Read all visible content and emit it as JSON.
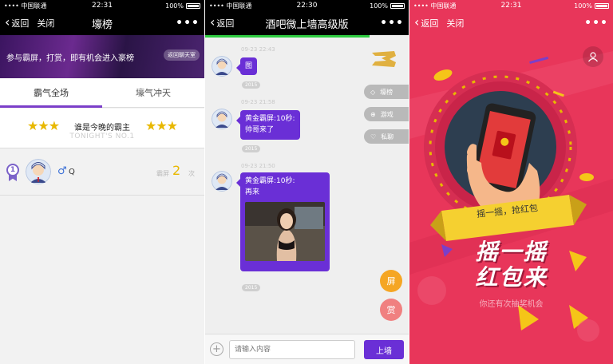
{
  "status": [
    {
      "carrier": "•••• 中国联通",
      "time": "22:31",
      "battery": "100%"
    },
    {
      "carrier": "•••• 中国联通",
      "time": "22:30",
      "battery": "100%"
    },
    {
      "carrier": "•••• 中国联通",
      "time": "22:31",
      "battery": "100%"
    }
  ],
  "panel1": {
    "nav": {
      "back": "返回",
      "close": "关闭",
      "title": "壕榜",
      "more": "•••"
    },
    "banner": {
      "text": "参与霸屏，打赏，即有机会进入豪榜",
      "button": "返回聊天室"
    },
    "tabs": [
      {
        "label": "霸气全场",
        "active": true
      },
      {
        "label": "壕气冲天",
        "active": false
      }
    ],
    "hero": {
      "stars": "★★★",
      "title": "谁是今晚的霸主",
      "subtitle": "TONIGHT'S NO.1"
    },
    "rank": {
      "position": "1",
      "gender_icon": "male-icon",
      "name": "Q",
      "score_label": "霸屏",
      "score": "2",
      "unit": "次"
    }
  },
  "panel2": {
    "nav": {
      "back": "返回",
      "title": "酒吧微上墙高级版",
      "more": "•••"
    },
    "messages": [
      {
        "time": "09-23 22:43",
        "sender": "",
        "text": "图",
        "tag": "2015"
      },
      {
        "time": "09-23 21:58",
        "sender": "黄金霸屏:10秒:",
        "text": "帅哥来了",
        "tag": "2015"
      },
      {
        "time": "09-23 21:50",
        "sender": "黄金霸屏:10秒:",
        "text": "再来",
        "tag": "2015"
      }
    ],
    "side_buttons": [
      {
        "label": "壕榜",
        "icon": "diamond-icon"
      },
      {
        "label": "游戏",
        "icon": "gamepad-icon"
      },
      {
        "label": "私聊",
        "icon": "heart-icon"
      }
    ],
    "float_buttons": [
      {
        "label": "屏",
        "color": "#f5a623"
      },
      {
        "label": "赏",
        "color": "#f08080"
      }
    ],
    "input": {
      "placeholder": "请输入内容",
      "value": "",
      "send": "上墙"
    }
  },
  "panel3": {
    "nav": {
      "back": "返回",
      "close": "关闭",
      "more": "•••"
    },
    "ribbon": "摇一摇，抢红包",
    "title_line1": "摇一摇",
    "title_line2": "红包来",
    "chance": "你还有次抽奖机会"
  },
  "colors": {
    "accent": "#6a2fd6",
    "gold": "#e8b800",
    "red_bg": "#e8365a"
  }
}
